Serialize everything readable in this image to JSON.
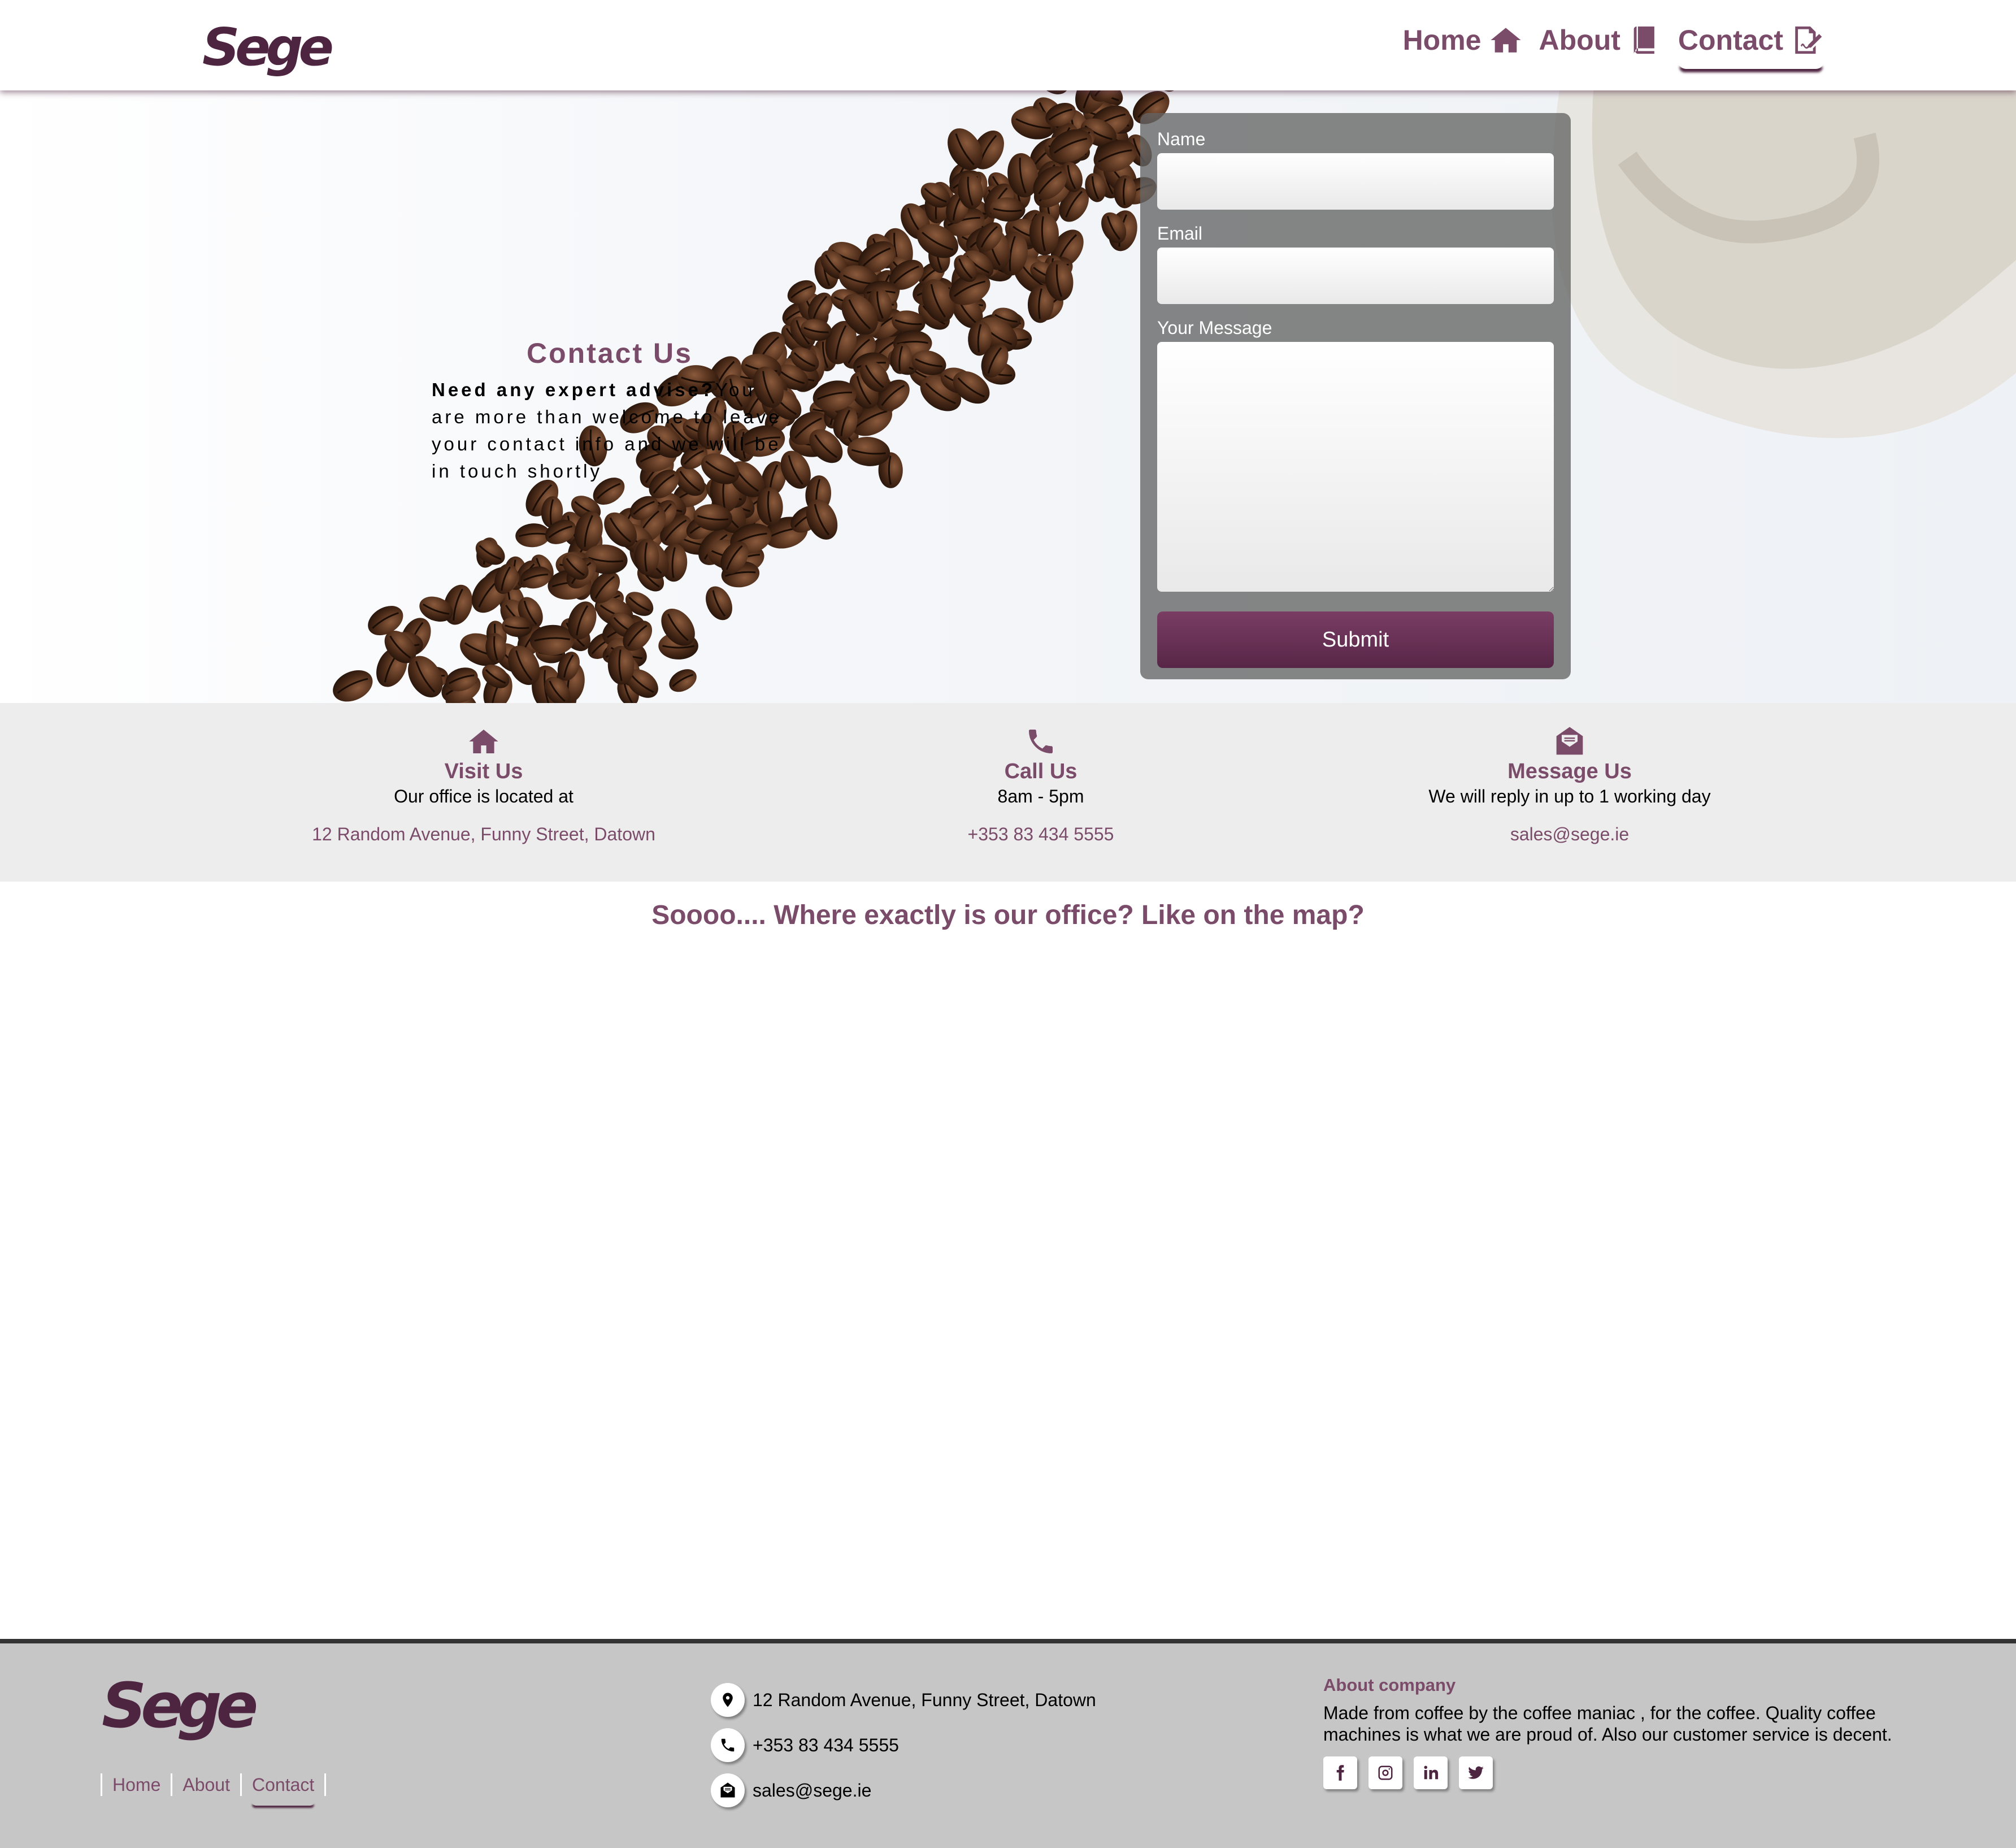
{
  "nav": {
    "logo": "Sege",
    "links": [
      {
        "label": "Home",
        "icon": "home-icon"
      },
      {
        "label": "About",
        "icon": "book-icon"
      },
      {
        "label": "Contact",
        "icon": "signature-icon"
      }
    ],
    "active": "Contact"
  },
  "hero": {
    "title": "Contact Us",
    "lead_bold": "Need any expert advise?",
    "lead_text": "You are more than welcome to leave your contact info and we will be in touch shortly"
  },
  "form": {
    "name_label": "Name",
    "email_label": "Email",
    "message_label": "Your Message",
    "submit_label": "Submit"
  },
  "info": [
    {
      "icon": "home-icon",
      "title": "Visit Us",
      "subtitle": "Our office is located at",
      "value": "12 Random Avenue, Funny Street, Datown"
    },
    {
      "icon": "phone-icon",
      "title": "Call Us",
      "subtitle": "8am - 5pm",
      "value": "+353 83 434 5555"
    },
    {
      "icon": "envelope-open-icon",
      "title": "Message Us",
      "subtitle": "We will reply in up to 1 working day",
      "value": "sales@sege.ie"
    }
  ],
  "map": {
    "title": "Soooo.... Where exactly is our office? Like on the map?"
  },
  "footer": {
    "logo": "Sege",
    "links": [
      "Home",
      "About",
      "Contact"
    ],
    "address": "12 Random Avenue, Funny Street, Datown",
    "phone": "+353 83 434 5555",
    "email": "sales@sege.ie",
    "about_title": "About company",
    "about_text": "Made from coffee by the coffee maniac , for the coffee. Quality coffee machines is what we are proud of. Also our customer service is decent.",
    "socials": [
      "facebook-icon",
      "instagram-icon",
      "linkedin-icon",
      "twitter-icon"
    ]
  },
  "colors": {
    "brand": "#7b4c6a",
    "brand_dark": "#4e2540",
    "info_bg": "#ededed",
    "footer_bg": "#c6c6c6"
  }
}
